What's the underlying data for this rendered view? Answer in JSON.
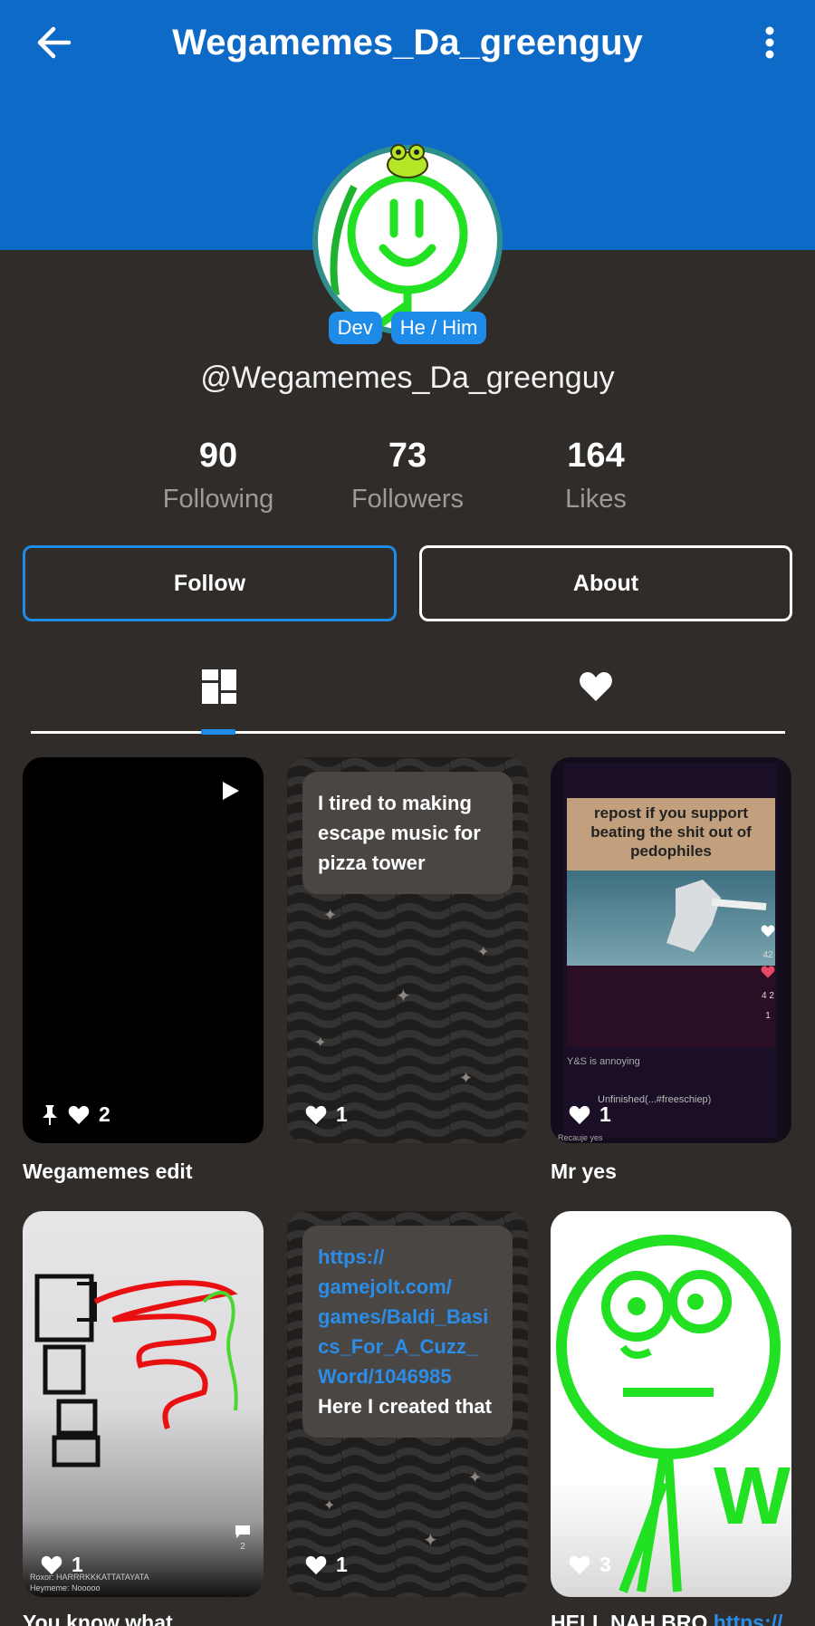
{
  "header": {
    "title": "Wegamemes_Da_greenguy",
    "accent": "#0d6ac6"
  },
  "profile": {
    "badges": [
      "Dev",
      "He / Him"
    ],
    "handle": "@Wegamemes_Da_greenguy"
  },
  "stats": {
    "following": {
      "value": "90",
      "label": "Following"
    },
    "followers": {
      "value": "73",
      "label": "Followers"
    },
    "likes": {
      "value": "164",
      "label": "Likes"
    }
  },
  "actions": {
    "follow_label": "Follow",
    "about_label": "About"
  },
  "tabs": {
    "posts_icon": "grid-icon",
    "likes_icon": "heart-icon",
    "active": "posts"
  },
  "posts": [
    {
      "likes": "2",
      "pinned": true,
      "caption": "Wegamemes edit",
      "kind": "video"
    },
    {
      "likes": "1",
      "caption": "",
      "kind": "text",
      "text": "I tired to making escape music for pizza tower"
    },
    {
      "likes": "1",
      "caption": "Mr yes",
      "kind": "image",
      "overlay_text": "repost if you support beating the shit out of pedophiles",
      "overlay_small": [
        "42",
        "4",
        "2",
        "1"
      ],
      "comment_1": "Y&S is annoying",
      "comment_2": "Unfinished(...#freeschiep)",
      "sub_1": "Recauje yes"
    },
    {
      "likes": "1",
      "caption": "You know what",
      "kind": "image",
      "overlay_small": [
        "2"
      ],
      "comment_1": "Roxor: HARRRKKKATTATAYATA",
      "comment_2": "Heymeme: Nooooo"
    },
    {
      "likes": "1",
      "caption": "",
      "kind": "text",
      "link": "https://gamejolt.com/games/Baldi_Basics_For_A_Cuzz_Word/1046985",
      "link_display": "https://\ngamejolt.com/\ngames/Baldi_Basi\ncs_For_A_Cuzz_\nWord/1046985",
      "text": "Here I created that"
    },
    {
      "likes": "3",
      "caption": "HELL NAH BRO ",
      "caption_link": "https://",
      "kind": "image"
    }
  ]
}
